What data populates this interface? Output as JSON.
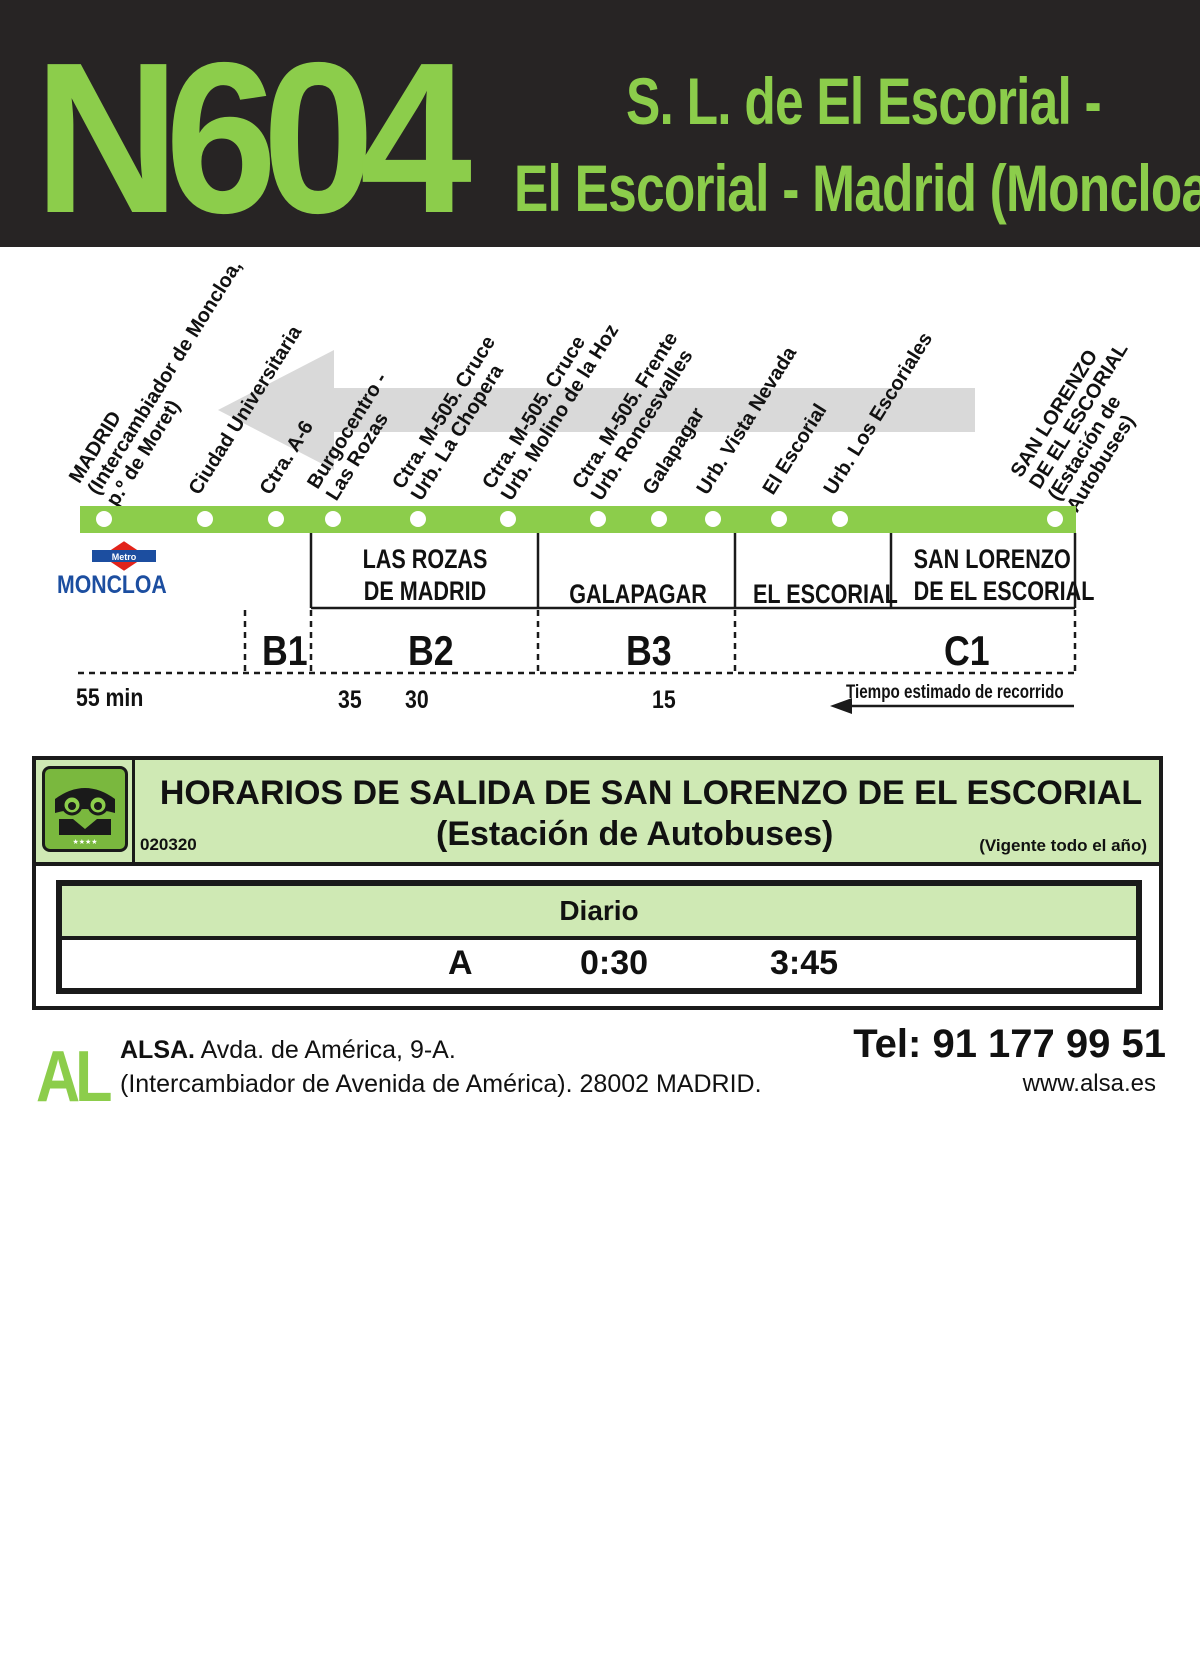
{
  "header": {
    "route_number": "N604",
    "route_name_line1": "S. L. de El Escorial -",
    "route_name_line2": "El Escorial - Madrid (Moncloa)"
  },
  "colors": {
    "brand_green": "#8ccd4b",
    "light_green": "#cfe9b4",
    "header_bg": "#272424",
    "metro_red": "#e2231a",
    "metro_blue": "#1c4ea0"
  },
  "stops": [
    {
      "lines": [
        "MADRID",
        "(Intercambiador de Moncloa,",
        "p.º de Moret)"
      ]
    },
    {
      "lines": [
        "Ciudad Universitaria"
      ]
    },
    {
      "lines": [
        "Ctra. A-6"
      ]
    },
    {
      "lines": [
        "Burgocentro -",
        "Las Rozas"
      ]
    },
    {
      "lines": [
        "Ctra. M-505. Cruce",
        "Urb. La Chopera"
      ]
    },
    {
      "lines": [
        "Ctra. M-505. Cruce",
        "Urb. Molino de la Hoz"
      ]
    },
    {
      "lines": [
        "Ctra. M-505. Frente",
        "Urb. Roncesvalles"
      ]
    },
    {
      "lines": [
        "Galapagar"
      ]
    },
    {
      "lines": [
        "Urb. Vista Nevada"
      ]
    },
    {
      "lines": [
        "El Escorial"
      ]
    },
    {
      "lines": [
        "Urb. Los Escoriales"
      ]
    },
    {
      "lines": [
        "SAN LORENZO",
        "DE EL ESCORIAL",
        "(Estación de",
        "Autobuses)"
      ]
    }
  ],
  "metro": {
    "badge": "Metro",
    "station": "MONCLOA"
  },
  "towns": [
    {
      "name_line1": "LAS ROZAS",
      "name_line2": "DE MADRID"
    },
    {
      "name_line1": "GALAPAGAR",
      "name_line2": ""
    },
    {
      "name_line1": "EL ESCORIAL",
      "name_line2": ""
    },
    {
      "name_line1": "SAN LORENZO",
      "name_line2": "DE EL ESCORIAL"
    }
  ],
  "zones": [
    "B1",
    "B2",
    "B3",
    "C1"
  ],
  "travel_times": {
    "t_madrid": "55 min",
    "t_rozas_a": "35",
    "t_rozas_b": "30",
    "t_galapagar": "15",
    "note": "Tiempo estimado de recorrido"
  },
  "schedule": {
    "title": "HORARIOS DE SALIDA DE SAN LORENZO DE EL ESCORIAL",
    "subtitle": "(Estación de Autobuses)",
    "code": "020320",
    "validity": "(Vigente todo el año)",
    "day": "Diario",
    "row_label": "A",
    "departures": [
      "0:30",
      "3:45"
    ]
  },
  "footer": {
    "logo_text": "AL",
    "company": "ALSA.",
    "address_line1": " Avda. de América, 9-A.",
    "address_line2": "(Intercambiador de Avenida de América). 28002 MADRID.",
    "phone": "Tel: 91 177 99 51",
    "website": "www.alsa.es"
  }
}
